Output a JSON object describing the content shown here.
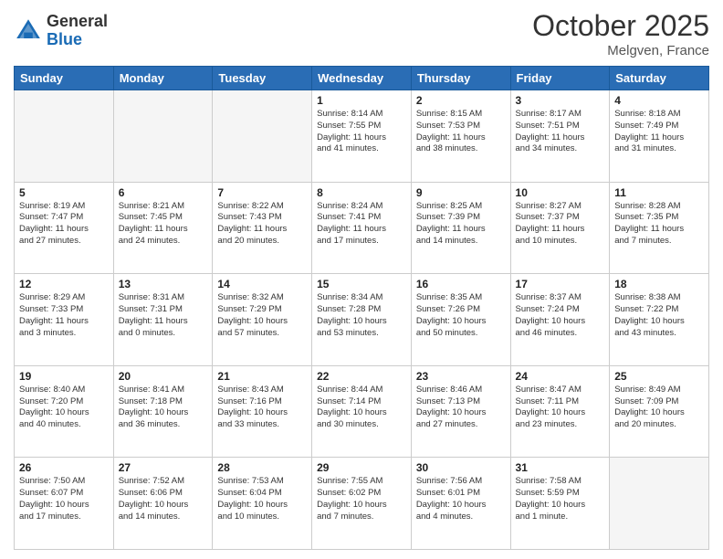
{
  "header": {
    "logo_general": "General",
    "logo_blue": "Blue",
    "month": "October 2025",
    "location": "Melgven, France"
  },
  "days_of_week": [
    "Sunday",
    "Monday",
    "Tuesday",
    "Wednesday",
    "Thursday",
    "Friday",
    "Saturday"
  ],
  "weeks": [
    [
      {
        "day": "",
        "info": ""
      },
      {
        "day": "",
        "info": ""
      },
      {
        "day": "",
        "info": ""
      },
      {
        "day": "1",
        "info": "Sunrise: 8:14 AM\nSunset: 7:55 PM\nDaylight: 11 hours\nand 41 minutes."
      },
      {
        "day": "2",
        "info": "Sunrise: 8:15 AM\nSunset: 7:53 PM\nDaylight: 11 hours\nand 38 minutes."
      },
      {
        "day": "3",
        "info": "Sunrise: 8:17 AM\nSunset: 7:51 PM\nDaylight: 11 hours\nand 34 minutes."
      },
      {
        "day": "4",
        "info": "Sunrise: 8:18 AM\nSunset: 7:49 PM\nDaylight: 11 hours\nand 31 minutes."
      }
    ],
    [
      {
        "day": "5",
        "info": "Sunrise: 8:19 AM\nSunset: 7:47 PM\nDaylight: 11 hours\nand 27 minutes."
      },
      {
        "day": "6",
        "info": "Sunrise: 8:21 AM\nSunset: 7:45 PM\nDaylight: 11 hours\nand 24 minutes."
      },
      {
        "day": "7",
        "info": "Sunrise: 8:22 AM\nSunset: 7:43 PM\nDaylight: 11 hours\nand 20 minutes."
      },
      {
        "day": "8",
        "info": "Sunrise: 8:24 AM\nSunset: 7:41 PM\nDaylight: 11 hours\nand 17 minutes."
      },
      {
        "day": "9",
        "info": "Sunrise: 8:25 AM\nSunset: 7:39 PM\nDaylight: 11 hours\nand 14 minutes."
      },
      {
        "day": "10",
        "info": "Sunrise: 8:27 AM\nSunset: 7:37 PM\nDaylight: 11 hours\nand 10 minutes."
      },
      {
        "day": "11",
        "info": "Sunrise: 8:28 AM\nSunset: 7:35 PM\nDaylight: 11 hours\nand 7 minutes."
      }
    ],
    [
      {
        "day": "12",
        "info": "Sunrise: 8:29 AM\nSunset: 7:33 PM\nDaylight: 11 hours\nand 3 minutes."
      },
      {
        "day": "13",
        "info": "Sunrise: 8:31 AM\nSunset: 7:31 PM\nDaylight: 11 hours\nand 0 minutes."
      },
      {
        "day": "14",
        "info": "Sunrise: 8:32 AM\nSunset: 7:29 PM\nDaylight: 10 hours\nand 57 minutes."
      },
      {
        "day": "15",
        "info": "Sunrise: 8:34 AM\nSunset: 7:28 PM\nDaylight: 10 hours\nand 53 minutes."
      },
      {
        "day": "16",
        "info": "Sunrise: 8:35 AM\nSunset: 7:26 PM\nDaylight: 10 hours\nand 50 minutes."
      },
      {
        "day": "17",
        "info": "Sunrise: 8:37 AM\nSunset: 7:24 PM\nDaylight: 10 hours\nand 46 minutes."
      },
      {
        "day": "18",
        "info": "Sunrise: 8:38 AM\nSunset: 7:22 PM\nDaylight: 10 hours\nand 43 minutes."
      }
    ],
    [
      {
        "day": "19",
        "info": "Sunrise: 8:40 AM\nSunset: 7:20 PM\nDaylight: 10 hours\nand 40 minutes."
      },
      {
        "day": "20",
        "info": "Sunrise: 8:41 AM\nSunset: 7:18 PM\nDaylight: 10 hours\nand 36 minutes."
      },
      {
        "day": "21",
        "info": "Sunrise: 8:43 AM\nSunset: 7:16 PM\nDaylight: 10 hours\nand 33 minutes."
      },
      {
        "day": "22",
        "info": "Sunrise: 8:44 AM\nSunset: 7:14 PM\nDaylight: 10 hours\nand 30 minutes."
      },
      {
        "day": "23",
        "info": "Sunrise: 8:46 AM\nSunset: 7:13 PM\nDaylight: 10 hours\nand 27 minutes."
      },
      {
        "day": "24",
        "info": "Sunrise: 8:47 AM\nSunset: 7:11 PM\nDaylight: 10 hours\nand 23 minutes."
      },
      {
        "day": "25",
        "info": "Sunrise: 8:49 AM\nSunset: 7:09 PM\nDaylight: 10 hours\nand 20 minutes."
      }
    ],
    [
      {
        "day": "26",
        "info": "Sunrise: 7:50 AM\nSunset: 6:07 PM\nDaylight: 10 hours\nand 17 minutes."
      },
      {
        "day": "27",
        "info": "Sunrise: 7:52 AM\nSunset: 6:06 PM\nDaylight: 10 hours\nand 14 minutes."
      },
      {
        "day": "28",
        "info": "Sunrise: 7:53 AM\nSunset: 6:04 PM\nDaylight: 10 hours\nand 10 minutes."
      },
      {
        "day": "29",
        "info": "Sunrise: 7:55 AM\nSunset: 6:02 PM\nDaylight: 10 hours\nand 7 minutes."
      },
      {
        "day": "30",
        "info": "Sunrise: 7:56 AM\nSunset: 6:01 PM\nDaylight: 10 hours\nand 4 minutes."
      },
      {
        "day": "31",
        "info": "Sunrise: 7:58 AM\nSunset: 5:59 PM\nDaylight: 10 hours\nand 1 minute."
      },
      {
        "day": "",
        "info": ""
      }
    ]
  ]
}
